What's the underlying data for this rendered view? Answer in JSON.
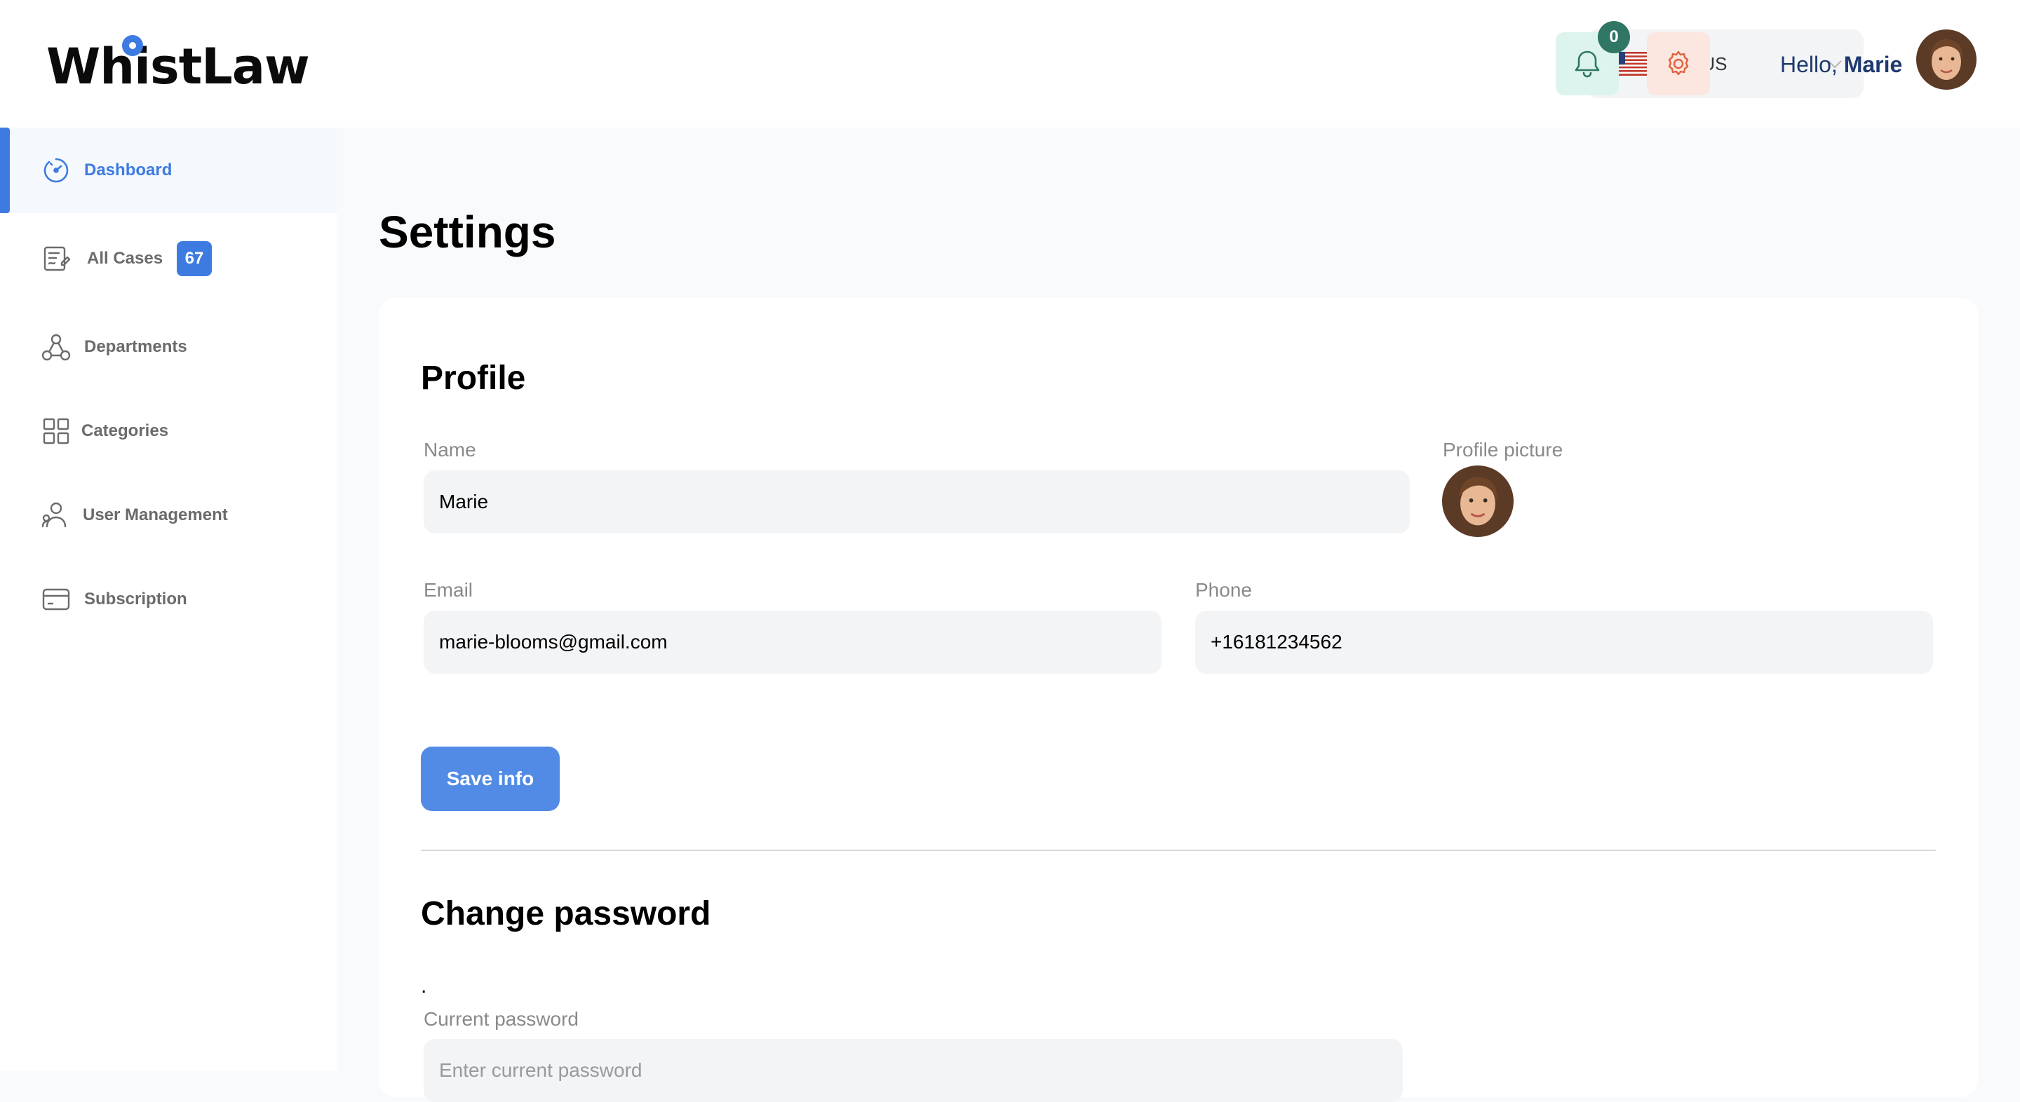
{
  "app": {
    "logo_text": "WhistLaw",
    "accent_color": "#3d7be0"
  },
  "sidebar": {
    "items": [
      {
        "label": "Dashboard",
        "icon": "dashboard-icon",
        "active": true
      },
      {
        "label": "All Cases",
        "icon": "cases-icon",
        "badge": "67"
      },
      {
        "label": "Departments",
        "icon": "departments-icon"
      },
      {
        "label": "Categories",
        "icon": "categories-icon"
      },
      {
        "label": "User Management",
        "icon": "user-management-icon"
      },
      {
        "label": "Subscription",
        "icon": "subscription-icon"
      }
    ]
  },
  "header": {
    "language": {
      "label": "EN US",
      "flag": "us-flag-icon"
    },
    "notifications": {
      "count": "0",
      "icon": "bell-icon"
    },
    "settings_icon": "gear-icon",
    "greeting": "Hello,",
    "user_name": "Marie"
  },
  "main": {
    "title": "Settings",
    "profile": {
      "title": "Profile",
      "name_label": "Name",
      "name_value": "Marie",
      "picture_label": "Profile picture",
      "email_label": "Email",
      "email_value": "marie-blooms@gmail.com",
      "phone_label": "Phone",
      "phone_value": "+16181234562",
      "save_label": "Save info"
    },
    "password": {
      "title": "Change password",
      "dot": ".",
      "current_label": "Current password",
      "current_placeholder": "Enter current password"
    }
  }
}
